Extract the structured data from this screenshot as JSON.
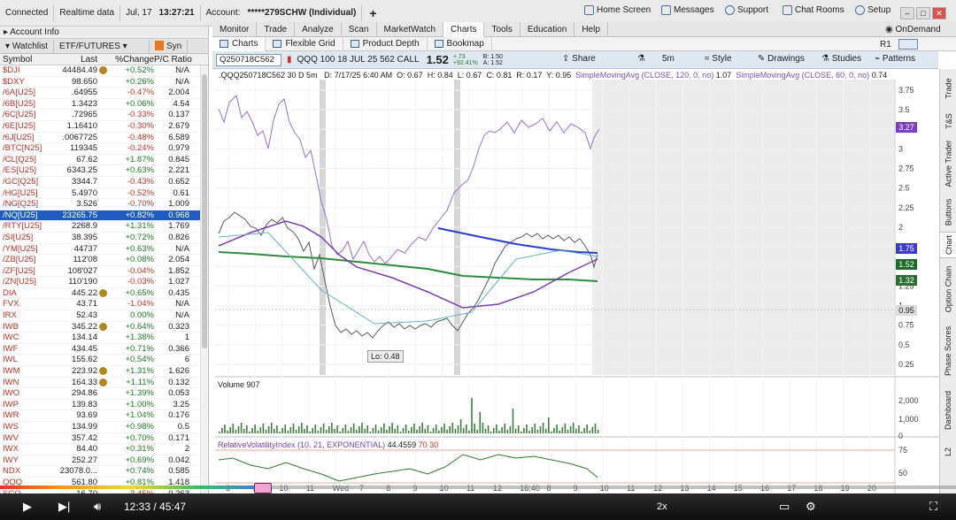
{
  "topbar": {
    "connected": "Connected",
    "data_mode": "Realtime data",
    "date": "Jul, 17",
    "time": "13:27:21",
    "account_label": "Account:",
    "account_value": "*****279SCHW (Individual)",
    "home_screen": "Home Screen",
    "messages": "Messages",
    "support": "Support",
    "chat_rooms": "Chat Rooms",
    "setup": "Setup"
  },
  "left": {
    "account_info": "Account Info",
    "tabs": [
      "Watchlist",
      "ETF/FUTURES",
      "Syn"
    ],
    "headers": {
      "symbol": "Symbol",
      "last": "Last",
      "change": "%Change",
      "ratio": "P/C Ratio"
    },
    "rows": [
      {
        "sym": "$DJI",
        "last": "44484.49",
        "dot": true,
        "chg": "+0.52%",
        "ratio": "N/A"
      },
      {
        "sym": "$DXY",
        "last": "98.650",
        "dot": false,
        "chg": "+0.26%",
        "ratio": "N/A"
      },
      {
        "sym": "/6A[U25]",
        "last": ".64955",
        "dot": false,
        "chg": "-0.47%",
        "ratio": "2.004"
      },
      {
        "sym": "/6B[U25]",
        "last": "1.3423",
        "dot": false,
        "chg": "+0.06%",
        "ratio": "4.54"
      },
      {
        "sym": "/6C[U25]",
        "last": ".72965",
        "dot": false,
        "chg": "-0.33%",
        "ratio": "0.137"
      },
      {
        "sym": "/6E[U25]",
        "last": "1.16410",
        "dot": false,
        "chg": "-0.30%",
        "ratio": "2.679"
      },
      {
        "sym": "/6J[U25]",
        "last": ".0067725",
        "dot": false,
        "chg": "-0.48%",
        "ratio": "6.589"
      },
      {
        "sym": "/BTC[N25]",
        "last": "119345",
        "dot": false,
        "chg": "-0.24%",
        "ratio": "0.979"
      },
      {
        "sym": "/CL[Q25]",
        "last": "67.62",
        "dot": false,
        "chg": "+1.87%",
        "ratio": "0.845"
      },
      {
        "sym": "/ES[U25]",
        "last": "6343.25",
        "dot": false,
        "chg": "+0.63%",
        "ratio": "2.221"
      },
      {
        "sym": "/GC[Q25]",
        "last": "3344.7",
        "dot": false,
        "chg": "-0.43%",
        "ratio": "0.652"
      },
      {
        "sym": "/HG[U25]",
        "last": "5.4970",
        "dot": false,
        "chg": "-0.52%",
        "ratio": "0.61"
      },
      {
        "sym": "/NG[Q25]",
        "last": "3.526",
        "dot": false,
        "chg": "-0.70%",
        "ratio": "1.009"
      },
      {
        "sym": "/NQ[U25]",
        "last": "23265.75",
        "dot": false,
        "chg": "+0.82%",
        "ratio": "0.968",
        "selected": true
      },
      {
        "sym": "/RTY[U25]",
        "last": "2268.9",
        "dot": false,
        "chg": "+1.31%",
        "ratio": "1.769"
      },
      {
        "sym": "/SI[U25]",
        "last": "38.395",
        "dot": false,
        "chg": "+0.72%",
        "ratio": "0.826"
      },
      {
        "sym": "/YM[U25]",
        "last": "44737",
        "dot": false,
        "chg": "+0.63%",
        "ratio": "N/A"
      },
      {
        "sym": "/ZB[U25]",
        "last": "112'08",
        "dot": false,
        "chg": "+0.08%",
        "ratio": "2.054"
      },
      {
        "sym": "/ZF[U25]",
        "last": "108'027",
        "dot": false,
        "chg": "-0.04%",
        "ratio": "1.852"
      },
      {
        "sym": "/ZN[U25]",
        "last": "110'190",
        "dot": false,
        "chg": "-0.03%",
        "ratio": "1.027"
      },
      {
        "sym": "DIA",
        "last": "445.22",
        "dot": true,
        "chg": "+0.65%",
        "ratio": "0.435"
      },
      {
        "sym": "FVX",
        "last": "43.71",
        "dot": false,
        "chg": "-1.04%",
        "ratio": "N/A"
      },
      {
        "sym": "IRX",
        "last": "52.43",
        "dot": false,
        "chg": "0.00%",
        "ratio": "N/A"
      },
      {
        "sym": "IWB",
        "last": "345.22",
        "dot": true,
        "chg": "+0.64%",
        "ratio": "0.323"
      },
      {
        "sym": "IWC",
        "last": "134.14",
        "dot": false,
        "chg": "+1.38%",
        "ratio": "1"
      },
      {
        "sym": "IWF",
        "last": "434.45",
        "dot": false,
        "chg": "+0.71%",
        "ratio": "0.366"
      },
      {
        "sym": "IWL",
        "last": "155.62",
        "dot": false,
        "chg": "+0.54%",
        "ratio": "6"
      },
      {
        "sym": "IWM",
        "last": "223.92",
        "dot": true,
        "chg": "+1.31%",
        "ratio": "1.626"
      },
      {
        "sym": "IWN",
        "last": "164.33",
        "dot": true,
        "chg": "+1.11%",
        "ratio": "0.132"
      },
      {
        "sym": "IWO",
        "last": "294.86",
        "dot": false,
        "chg": "+1.39%",
        "ratio": "0.053"
      },
      {
        "sym": "IWP",
        "last": "139.83",
        "dot": false,
        "chg": "+1.00%",
        "ratio": "3.25"
      },
      {
        "sym": "IWR",
        "last": "93.69",
        "dot": false,
        "chg": "+1.04%",
        "ratio": "0.176"
      },
      {
        "sym": "IWS",
        "last": "134.99",
        "dot": false,
        "chg": "+0.98%",
        "ratio": "0.5"
      },
      {
        "sym": "IWV",
        "last": "357.42",
        "dot": false,
        "chg": "+0.70%",
        "ratio": "0.171"
      },
      {
        "sym": "IWX",
        "last": "84.40",
        "dot": false,
        "chg": "+0.31%",
        "ratio": "2"
      },
      {
        "sym": "IWY",
        "last": "252.27",
        "dot": false,
        "chg": "+0.69%",
        "ratio": "0.042"
      },
      {
        "sym": "NDX",
        "last": "23078.0...",
        "dot": false,
        "chg": "+0.74%",
        "ratio": "0.585"
      },
      {
        "sym": "QQQ",
        "last": "561.80",
        "dot": false,
        "chg": "+0.81%",
        "ratio": "1.418"
      },
      {
        "sym": "SCO",
        "last": "16.70",
        "dot": false,
        "chg": "-2.45%",
        "ratio": "0.263"
      }
    ]
  },
  "nav": {
    "tabs": [
      "Monitor",
      "Trade",
      "Analyze",
      "Scan",
      "MarketWatch",
      "Charts",
      "Tools",
      "Education",
      "Help"
    ],
    "active": "Charts",
    "ondemand": "OnDemand",
    "r1": "R1"
  },
  "subnav": {
    "tabs": [
      "Charts",
      "Flexible Grid",
      "Product Depth",
      "Bookmap"
    ]
  },
  "chart_toolbar": {
    "symbol": "Q250718C562",
    "description": "QQQ 100 18 JUL 25 562 CALL",
    "last": "1.52",
    "change": "+.73",
    "change_pct": "+92.41%",
    "bid": "B: 1.50",
    "ask": "A: 1.52",
    "share": "Share",
    "timeframe": "5m",
    "style": "Style",
    "drawings": "Drawings",
    "studies": "Studies",
    "patterns": "Patterns"
  },
  "chart_info": {
    "symbol_line": ".QQQ250718C562 30 D 5m",
    "date": "D: 7/17/25 6:40 AM",
    "open": "O: 0.67",
    "high": "H: 0.84",
    "low": "L: 0.67",
    "close": "C: 0.81",
    "range": "R: 0.17",
    "y": "Y: 0.95",
    "sma1": "SimpleMovingAvg (CLOSE, 120, 0, no)",
    "sma1_val": "1.07",
    "sma2": "SimpleMovingAvg (CLOSE, 60, 0, no)",
    "sma2_val": "0.74",
    "lo_label": "Lo: 0.48",
    "price_ticks": [
      "3.75",
      "3.5",
      "3.25",
      "3",
      "2.75",
      "2.5",
      "2.25",
      "2",
      "1.75",
      "1.5",
      "1.25",
      "1",
      "0.75",
      "0.5",
      "0.25"
    ],
    "tags": [
      {
        "value": "3.27",
        "color": "#7b3fb8"
      },
      {
        "value": "1.75",
        "color": "#3c3cc8"
      },
      {
        "value": "1.52",
        "color": "#1d6b2a"
      },
      {
        "value": "1.32",
        "color": "#2d6d36"
      },
      {
        "value": "0.95",
        "color": "#dcdcdc"
      }
    ],
    "volume_label": "Volume",
    "volume_value": "907",
    "volume_ticks": [
      "2,000",
      "1,000",
      "0"
    ],
    "rvi_label": "RelativeVolatilityIndex (10, 21, EXPONENTIAL)",
    "rvi_value": "44.4559",
    "rvi_levels": "70 30",
    "rvi_ticks": [
      "75",
      "50"
    ],
    "time_ticks": [
      "8",
      "9",
      "10",
      "11",
      "Wed",
      "7",
      "8",
      "9",
      "10",
      "11",
      "12",
      "16:40",
      "8",
      "9",
      "10",
      "11",
      "12",
      "13",
      "14",
      "15",
      "16",
      "17",
      "18",
      "19",
      "20"
    ]
  },
  "right_tabs": [
    "Trade",
    "T&S",
    "Active Trader",
    "Buttons",
    "Chart",
    "Option Chain",
    "Phase Scores",
    "Dashboard",
    "L2"
  ],
  "player": {
    "time": "12:33 / 45:47",
    "speed": "2x"
  }
}
